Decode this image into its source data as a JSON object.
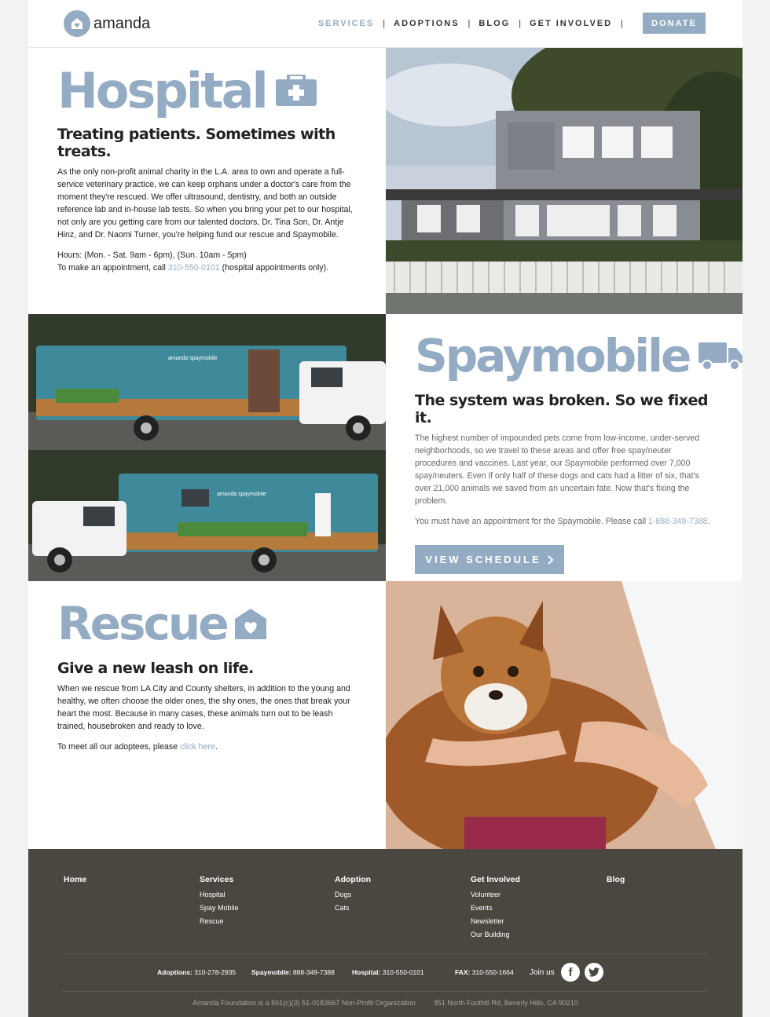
{
  "header": {
    "logo_text": "amanda",
    "nav": [
      {
        "label": "SERVICES",
        "active": true
      },
      {
        "label": "ADOPTIONS",
        "active": false
      },
      {
        "label": "BLOG",
        "active": false
      },
      {
        "label": "GET INVOLVED",
        "active": false
      }
    ],
    "nav_separator": "|",
    "donate_label": "DONATE"
  },
  "hospital": {
    "title": "Hospital",
    "icon": "medical-kit-icon",
    "subheading": "Treating patients. Sometimes with treats.",
    "paragraph": "As the only non-profit animal charity in the L.A. area to own and operate a full-service veterinary practice, we can keep orphans under a doctor's care from the moment they're rescued. We offer ultrasound, dentistry, and both an outside reference lab and in-house lab tests. So when you bring your pet to our hospital, not only are you getting care from our talented doctors, Dr. Tina Son, Dr. Antje Hinz, and Dr. Naomi Turner, you're helping fund our rescue and Spaymobile.",
    "hours": "Hours: (Mon. - Sat. 9am - 6pm), (Sun. 10am - 5pm)",
    "appointment_prefix": "To make an appointment, call ",
    "appointment_phone": "310-550-0101",
    "appointment_suffix": " (hospital appointments only)."
  },
  "spaymobile": {
    "title": "Spaymobile",
    "icon": "truck-icon",
    "subheading": "The system was broken. So we fixed it.",
    "paragraph": "The highest number of impounded pets come from low-income, under-served neighborhoods, so we travel to these areas and offer free spay/neuter procedures and vaccines. Last year, our Spaymobile performed over 7,000 spay/neuters. Even if only half of these dogs and cats had a litter of six, that's over 21,000 animals we saved from an uncertain fate. Now that's fixing the problem.",
    "appointment_prefix": "You must have an appointment for the Spaymobile. Please call ",
    "appointment_phone": "1-888-349-7388",
    "appointment_suffix": ".",
    "button_label": "VIEW SCHEDULE",
    "van_brand": "amanda spaymobile"
  },
  "rescue": {
    "title": "Rescue",
    "icon": "home-heart-icon",
    "subheading": "Give a new leash on life.",
    "paragraph": "When we rescue from LA City and County shelters, in addition to the young and healthy, we often choose the older ones, the shy ones, the ones that break your heart the most. Because in many cases, these animals turn out to be leash trained, housebroken and ready to love.",
    "meet_prefix": "To meet all our adoptees, please ",
    "meet_link": "click here",
    "meet_suffix": "."
  },
  "footer": {
    "columns": [
      {
        "heading": "Home",
        "links": []
      },
      {
        "heading": "Services",
        "links": [
          "Hospital",
          "Spay Mobile",
          "Rescue"
        ]
      },
      {
        "heading": "Adoption",
        "links": [
          "Dogs",
          "Cats"
        ]
      },
      {
        "heading": "Get Involved",
        "links": [
          "Volunteer",
          "Events",
          "Newsletter",
          "Our Building"
        ]
      },
      {
        "heading": "Blog",
        "links": []
      }
    ],
    "contacts": [
      {
        "label": "Adoptions:",
        "value": " 310-278-2935"
      },
      {
        "label": "Spaymobile:",
        "value": " 888-349-7388"
      },
      {
        "label": "Hospital:",
        "value": " 310-550-0101"
      },
      {
        "label": "FAX:",
        "value": " 310-550-1664"
      }
    ],
    "join_label": "Join us",
    "social": [
      "facebook-icon",
      "twitter-icon"
    ],
    "org_line": "Amanda Foundation is a 501(c)(3) 51-0183667 Non-Profit Organization",
    "address": "351 North Foothill Rd, Beverly Hills, CA 90210"
  },
  "colors": {
    "accent": "#94abc4",
    "footer_bg": "#4a4740",
    "van_teal": "#3f8a9a"
  }
}
